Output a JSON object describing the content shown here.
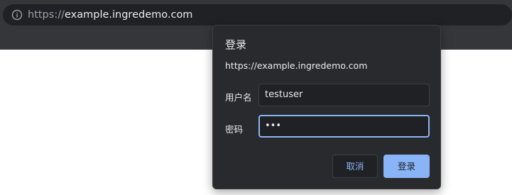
{
  "browser": {
    "address_bar": {
      "info_icon": "info-circle-icon",
      "url_scheme": "https://",
      "url_host": "example.ingredemo.com"
    }
  },
  "login_dialog": {
    "title": "登录",
    "origin": "https://example.ingredemo.com",
    "username": {
      "label": "用户名",
      "value": "testuser"
    },
    "password": {
      "label": "密码",
      "value": "•••"
    },
    "buttons": {
      "cancel_label": "取消",
      "submit_label": "登录"
    }
  },
  "colors": {
    "chrome_toolbar": "#35363a",
    "omnibox": "#202124",
    "dialog_bg": "#292a2d",
    "accent": "#8ab4f8",
    "text": "#e8eaed"
  }
}
